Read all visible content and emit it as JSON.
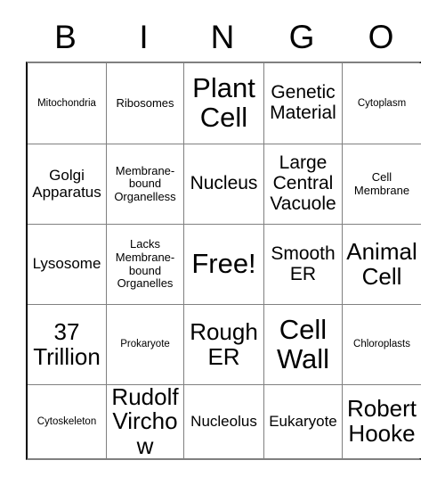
{
  "card": {
    "header": {
      "letters": [
        "B",
        "I",
        "N",
        "G",
        "O"
      ]
    },
    "rows": [
      [
        {
          "text": "Mitochondria",
          "size": "xs"
        },
        {
          "text": "Ribosomes",
          "size": "sm"
        },
        {
          "text": "Plant Cell",
          "size": "xxl"
        },
        {
          "text": "Genetic Material",
          "size": "lg"
        },
        {
          "text": "Cytoplasm",
          "size": "xs"
        }
      ],
      [
        {
          "text": "Golgi Apparatus",
          "size": "md"
        },
        {
          "text": "Membrane-bound Organelless",
          "size": "sm"
        },
        {
          "text": "Nucleus",
          "size": "lg"
        },
        {
          "text": "Large Central Vacuole",
          "size": "lg"
        },
        {
          "text": "Cell Membrane",
          "size": "sm"
        }
      ],
      [
        {
          "text": "Lysosome",
          "size": "md"
        },
        {
          "text": "Lacks Membrane-bound Organelles",
          "size": "sm"
        },
        {
          "text": "Free!",
          "size": "xxl"
        },
        {
          "text": "Smooth ER",
          "size": "lg"
        },
        {
          "text": "Animal Cell",
          "size": "xl"
        }
      ],
      [
        {
          "text": "37 Trillion",
          "size": "xl"
        },
        {
          "text": "Prokaryote",
          "size": "xs"
        },
        {
          "text": "Rough ER",
          "size": "xl"
        },
        {
          "text": "Cell Wall",
          "size": "xxl"
        },
        {
          "text": "Chloroplasts",
          "size": "xs"
        }
      ],
      [
        {
          "text": "Cytoskeleton",
          "size": "xs"
        },
        {
          "text": "Rudolf Virchow",
          "size": "xl"
        },
        {
          "text": "Nucleolus",
          "size": "md"
        },
        {
          "text": "Eukaryote",
          "size": "md"
        },
        {
          "text": "Robert Hooke",
          "size": "xl"
        }
      ]
    ]
  }
}
